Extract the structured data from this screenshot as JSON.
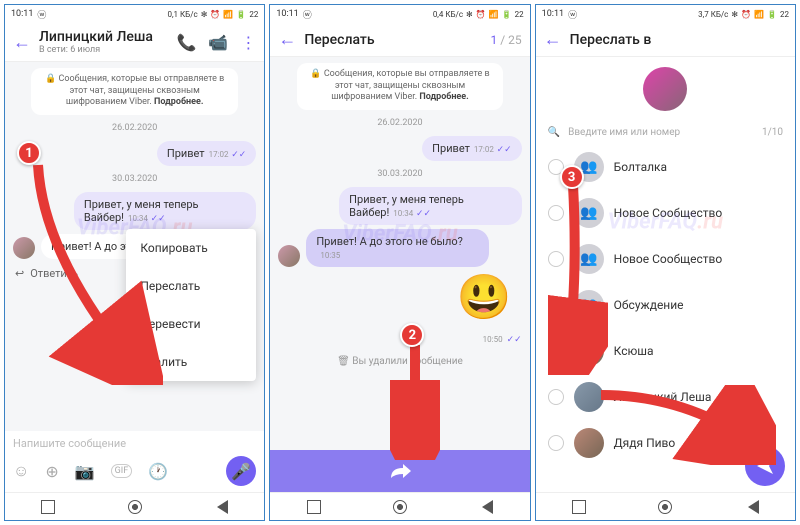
{
  "status": {
    "time": "10:11",
    "net1": "0,1 КБ/с",
    "net2": "0,4 КБ/с",
    "net3": "3,7 КБ/с",
    "bat": "22"
  },
  "watermark": {
    "a": "ViberFAQ",
    "b": ".ru"
  },
  "s1": {
    "title": "Липницкий Леша",
    "sub": "В сети: 6 июля",
    "e2e": "🔒 Сообщения, которые вы отправляете в этот чат, защищены сквозным шифрованием Viber.",
    "e2e_more": "Подробнее.",
    "d1": "26.02.2020",
    "m1": "Привет",
    "t1": "17:02",
    "d2": "30.03.2020",
    "m2": "Привет, у меня теперь Вайбер!",
    "t2": "10:34",
    "m3": "Привет! А до этого не было?",
    "t3": "",
    "reply": "Ответить",
    "menu": [
      "Копировать",
      "Переслать",
      "Перевести",
      "Удалить"
    ],
    "input_ph": "Напишите сообщение"
  },
  "s2": {
    "title": "Переслать",
    "cur": "1",
    "tot": "25",
    "e2e": "🔒 Сообщения, которые вы отправляете в этот чат, защищены сквозным шифрованием Viber.",
    "e2e_more": "Подробнее.",
    "d1": "26.02.2020",
    "m1": "Привет",
    "t1": "17:02",
    "d2": "30.03.2020",
    "m2": "Привет, у меня теперь Вайбер!",
    "t2": "10:34",
    "m3": "Привет! А до этого не было?",
    "t3": "10:35",
    "t4": "10:50",
    "deleted": "🗑 Вы удалили сообщение"
  },
  "s3": {
    "title": "Переслать в",
    "search_ph": "Введите имя или номер",
    "scount": "1/10",
    "contacts": [
      {
        "name": "Болталка",
        "icon": "group"
      },
      {
        "name": "Новое Сообщество",
        "icon": "group"
      },
      {
        "name": "Новое Сообщество",
        "icon": "group"
      },
      {
        "name": "Обсуждение",
        "icon": "group"
      },
      {
        "name": "Ксюша",
        "icon": "p1",
        "sel": true
      },
      {
        "name": "Липницкий Леша",
        "icon": "p2"
      },
      {
        "name": "Дядя Пиво",
        "icon": "p1"
      }
    ]
  },
  "badges": {
    "b1": "1",
    "b2": "2",
    "b3": "3"
  }
}
